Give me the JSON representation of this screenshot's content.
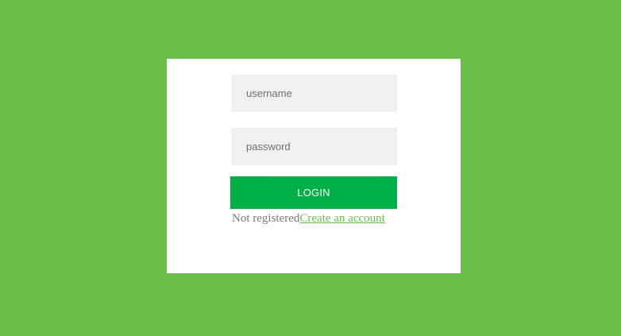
{
  "colors": {
    "page_background": "#6abe4a",
    "card_background": "#ffffff",
    "input_background": "#f0f0f0",
    "button_background": "#00b047",
    "link": "#6abe4a"
  },
  "login_form": {
    "username_value": "",
    "username_placeholder": "username",
    "password_value": "",
    "password_placeholder": "password",
    "login_button_label": "LOGIN",
    "not_registered_text": "Not registered",
    "create_account_link": "Create an account"
  }
}
